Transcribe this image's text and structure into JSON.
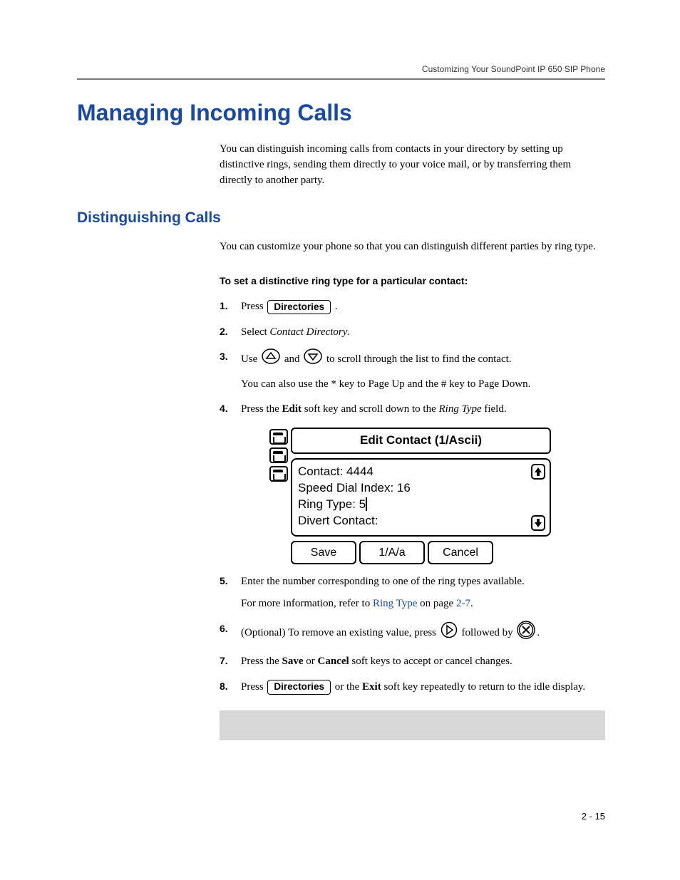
{
  "header": {
    "running": "Customizing Your SoundPoint IP 650 SIP Phone"
  },
  "h1": "Managing Incoming Calls",
  "intro": "You can distinguish incoming calls from contacts in your directory by setting up distinctive rings, sending them directly to your voice mail, or by transferring them directly to another party.",
  "h2": "Distinguishing Calls",
  "sub_intro": "You can customize your phone so that you can distinguish different parties by ring type.",
  "instr_heading": "To set a distinctive ring type for a particular contact:",
  "directories_label": "Directories",
  "steps": {
    "s1a": "Press ",
    "s1b": " .",
    "s2a": "Select ",
    "s2b": "Contact Directory",
    "s2c": ".",
    "s3a": "Use ",
    "s3b": " and ",
    "s3c": " to scroll through the list to find the contact.",
    "s3d": "You can also use the * key to Page Up and the # key to Page Down.",
    "s4a": "Press the ",
    "s4b": "Edit",
    "s4c": " soft key and scroll down to the ",
    "s4d": "Ring Type",
    "s4e": " field.",
    "s5a": "Enter the number corresponding to one of the ring types available.",
    "s5b": "For more information, refer to ",
    "s5c": "Ring Type",
    "s5d": " on page ",
    "s5e": "2-7",
    "s5f": ".",
    "s6a": "(Optional) To remove an existing value, press ",
    "s6b": " followed by ",
    "s6c": ".",
    "s7a": "Press the ",
    "s7b": "Save",
    "s7c": " or ",
    "s7d": "Cancel",
    "s7e": " soft keys to accept or cancel changes.",
    "s8a": "Press ",
    "s8b": " or the ",
    "s8c": "Exit",
    "s8d": " soft key repeatedly to return to the idle display."
  },
  "lcd": {
    "title": "Edit Contact (1/Ascii)",
    "line1": "Contact: 4444",
    "line2": "Speed Dial Index: 16",
    "line3": "Ring Type: 5",
    "line4": "Divert Contact:",
    "sk1": "Save",
    "sk2": "1/A/a",
    "sk3": "Cancel"
  },
  "pagenum": "2 - 15"
}
